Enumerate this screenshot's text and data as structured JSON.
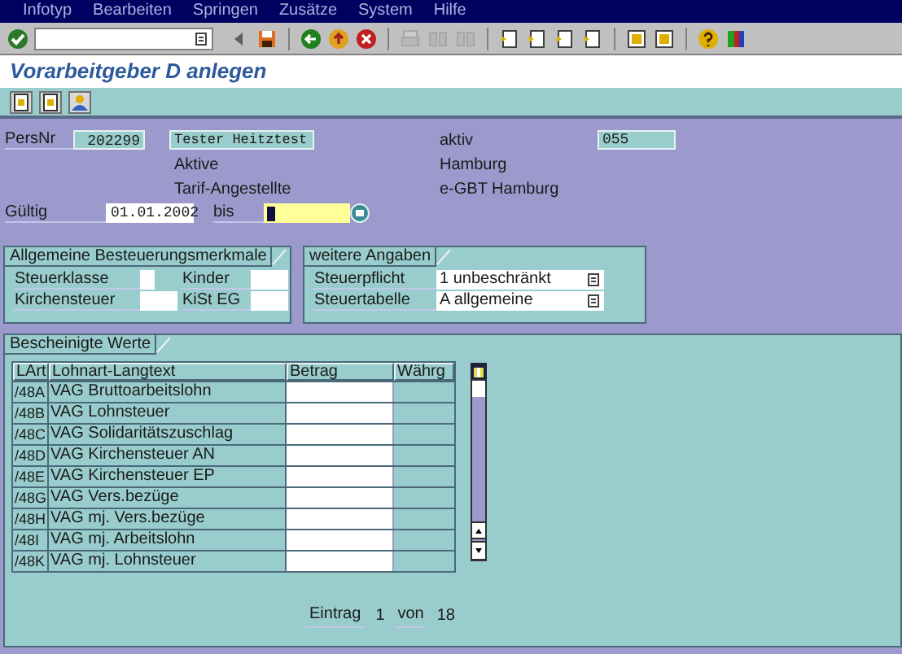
{
  "menu": [
    "Infotyp",
    "Bearbeiten",
    "Springen",
    "Zusätze",
    "System",
    "Hilfe"
  ],
  "toolbar": [
    {
      "kind": "enter",
      "disabled": false
    },
    {
      "kind": "command-field"
    },
    {
      "kind": "prev",
      "disabled": false
    },
    {
      "kind": "save",
      "disabled": false
    },
    {
      "kind": "sep"
    },
    {
      "kind": "back",
      "disabled": false
    },
    {
      "kind": "exit",
      "disabled": false
    },
    {
      "kind": "cancel",
      "disabled": false
    },
    {
      "kind": "sep"
    },
    {
      "kind": "print",
      "disabled": true
    },
    {
      "kind": "find",
      "disabled": true
    },
    {
      "kind": "find",
      "disabled": true
    },
    {
      "kind": "sep"
    },
    {
      "kind": "page",
      "disabled": false
    },
    {
      "kind": "page",
      "disabled": false
    },
    {
      "kind": "page",
      "disabled": false
    },
    {
      "kind": "page",
      "disabled": false
    },
    {
      "kind": "sep"
    },
    {
      "kind": "window",
      "disabled": false
    },
    {
      "kind": "window",
      "disabled": false
    },
    {
      "kind": "sep"
    },
    {
      "kind": "help",
      "disabled": false
    },
    {
      "kind": "layout",
      "disabled": false
    }
  ],
  "title": "Vorarbeitgeber D anlegen",
  "app_toolbar": [
    {
      "kind": "doc"
    },
    {
      "kind": "doc"
    },
    {
      "kind": "person"
    }
  ],
  "header": {
    "persnr_label": "PersNr",
    "persnr": "202299",
    "name": "Tester Heitztest",
    "status_label": "aktiv",
    "status_code": "055",
    "line_2": [
      "Aktive",
      "Hamburg"
    ],
    "line_3": [
      "Tarif-Angestellte",
      "e-GBT Hamburg"
    ],
    "valid_label": "Gültig",
    "valid_from": "01.01.2002",
    "to_label": "bis"
  },
  "groups": [
    {
      "title": "Allgemeine Besteuerungsmerkmale",
      "fields": [
        {
          "label": "Steuerklasse"
        },
        {
          "label": "Kinder"
        },
        {
          "label": "Kirchensteuer"
        },
        {
          "label": "KiSt EG"
        }
      ]
    },
    {
      "title": "weitere Angaben",
      "fields": [
        {
          "label": "Steuerpflicht",
          "value": "1 unbeschränkt"
        },
        {
          "label": "Steuertabelle",
          "value": "A allgemeine"
        }
      ]
    }
  ],
  "table": {
    "title": "Bescheinigte Werte",
    "columns": [
      "LArt",
      "Lohnart-Langtext",
      "Betrag",
      "Währg"
    ],
    "rows": [
      {
        "code": "/48A",
        "text": "VAG Bruttoarbeitslohn"
      },
      {
        "code": "/48B",
        "text": "VAG Lohnsteuer"
      },
      {
        "code": "/48C",
        "text": "VAG Solidaritätszuschlag"
      },
      {
        "code": "/48D",
        "text": "VAG Kirchensteuer AN"
      },
      {
        "code": "/48E",
        "text": "VAG Kirchensteuer EP"
      },
      {
        "code": "/48G",
        "text": "VAG Vers.bezüge"
      },
      {
        "code": "/48H",
        "text": "VAG mj. Vers.bezüge"
      },
      {
        "code": "/48I",
        "text": "VAG mj. Arbeitslohn"
      },
      {
        "code": "/48K",
        "text": "VAG mj. Lohnsteuer"
      }
    ]
  },
  "paging": {
    "entry_label": "Eintrag",
    "current": "1",
    "of_label": "von",
    "total": "18"
  }
}
